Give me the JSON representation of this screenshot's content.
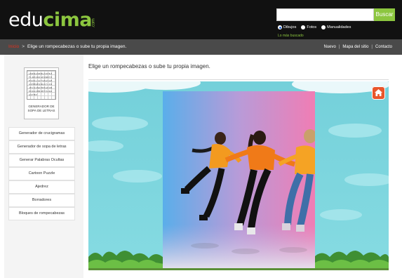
{
  "header": {
    "logo_part1": "edu",
    "logo_part2": "cima",
    "logo_part3": ".com",
    "search_placeholder": "",
    "search_button": "Buscar",
    "radios": [
      {
        "label": "Dibujos",
        "checked": true
      },
      {
        "label": "Fotos",
        "checked": false
      },
      {
        "label": "Manualidades",
        "checked": false
      }
    ],
    "mas_buscado": "Lo más buscado"
  },
  "breadcrumb": {
    "home": "Inicio",
    "separator": ">",
    "current": "Elige un rompecabezas o sube tu propia imagen."
  },
  "topnav": {
    "items": [
      "Nuevo",
      "Mapa del sitio",
      "Contacto"
    ]
  },
  "sidebar": {
    "wordsearch_title": "GENERADOR DE SOPA DE LETRAS",
    "wordsearch_letters": "LBERAXMBSJEPEZFLNEAKDAEQNBTPEIOULJATSRASAHAIMMWEQBUATLIRJECUINOPEKAKONEORAAMBUMTPARAGITMH",
    "menu": [
      "Generador de crucigramas",
      "Generador de sopa de letras",
      "Generar Palabras Ocultas",
      "Cartoon Puzzle",
      "Ajedrez",
      "Borradores",
      "Bloques de rompecabezas"
    ]
  },
  "main": {
    "title": "Elige un rompecabezas o sube tu propia imagen."
  },
  "colors": {
    "brand_green": "#8cc63f",
    "header_bg": "#111111",
    "crumb_bg": "#4a4a4a",
    "home_red": "#e0301e",
    "home_button": "#e8562b",
    "sky": "#7ad3dc"
  },
  "icons": {
    "home_button": "home-icon"
  }
}
